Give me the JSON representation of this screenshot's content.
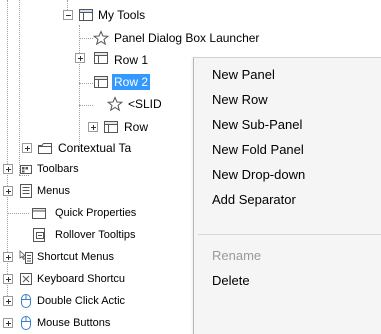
{
  "tree": {
    "nodes": [
      {
        "label": "My Tools",
        "icon": "panel-folder-icon"
      },
      {
        "label": "Panel Dialog Box Launcher",
        "icon": "star-icon"
      },
      {
        "label": "Row 1",
        "icon": "row-icon"
      },
      {
        "label": "Row 2",
        "icon": "row-icon",
        "selected": true
      },
      {
        "label": "<SLID",
        "icon": "star-icon"
      },
      {
        "label": "Row",
        "icon": "row-icon"
      },
      {
        "label": "Contextual Ta",
        "icon": "contextual-tab-icon"
      },
      {
        "label": "Toolbars",
        "icon": "toolbar-icon"
      },
      {
        "label": "Menus",
        "icon": "menu-icon"
      },
      {
        "label": "Quick Properties",
        "icon": "quick-properties-icon"
      },
      {
        "label": "Rollover Tooltips",
        "icon": "tooltip-icon"
      },
      {
        "label": "Shortcut Menus",
        "icon": "shortcut-menu-icon"
      },
      {
        "label": "Keyboard Shortcu",
        "icon": "keyboard-icon"
      },
      {
        "label": "Double Click Actic",
        "icon": "mouse-icon"
      },
      {
        "label": "Mouse Buttons",
        "icon": "mouse-icon"
      }
    ]
  },
  "context_menu": {
    "items": [
      {
        "label": "New Panel",
        "enabled": true
      },
      {
        "label": "New Row",
        "enabled": true
      },
      {
        "label": "New Sub-Panel",
        "enabled": true
      },
      {
        "label": "New Fold Panel",
        "enabled": true
      },
      {
        "label": "New Drop-down",
        "enabled": true
      },
      {
        "label": "Add Separator",
        "enabled": true
      },
      {
        "label": "Rename",
        "enabled": false
      },
      {
        "label": "Delete",
        "enabled": true
      }
    ]
  },
  "colors": {
    "selection": "#3399ff",
    "menu_background": "#f5f5f5",
    "disabled_text": "#9a9a9a"
  }
}
